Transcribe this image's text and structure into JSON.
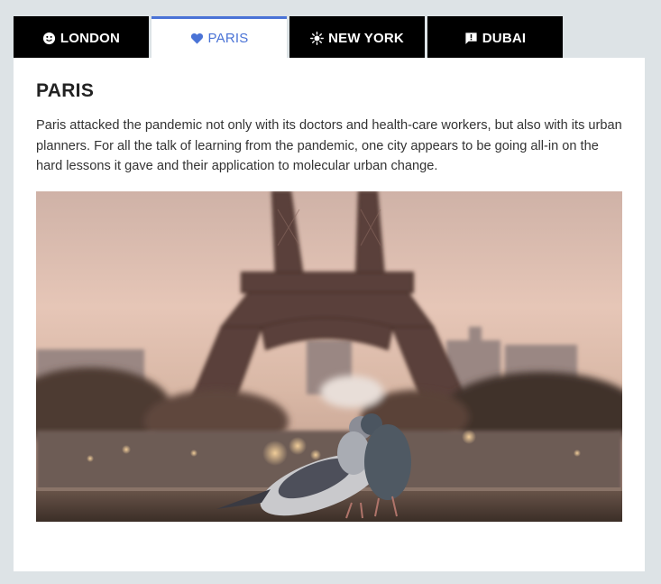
{
  "tabs": [
    {
      "label": "LONDON",
      "icon": "smiley-icon",
      "active": false
    },
    {
      "label": "PARIS",
      "icon": "heart-icon",
      "active": true
    },
    {
      "label": "NEW YORK",
      "icon": "sun-icon",
      "active": false
    },
    {
      "label": "DUBAI",
      "icon": "comment-flag-icon",
      "active": false
    }
  ],
  "content": {
    "title": "PARIS",
    "body": "Paris attacked the pandemic not only with its doctors and health-care workers, but also with its urban planners. For all the talk of learning from the pandemic, one city appears to be going all-in on the hard lessons it gave and their application to molecular urban change."
  },
  "colors": {
    "accent": "#4a73d6",
    "tab_bg": "#000000",
    "page_bg": "#dde3e6"
  }
}
